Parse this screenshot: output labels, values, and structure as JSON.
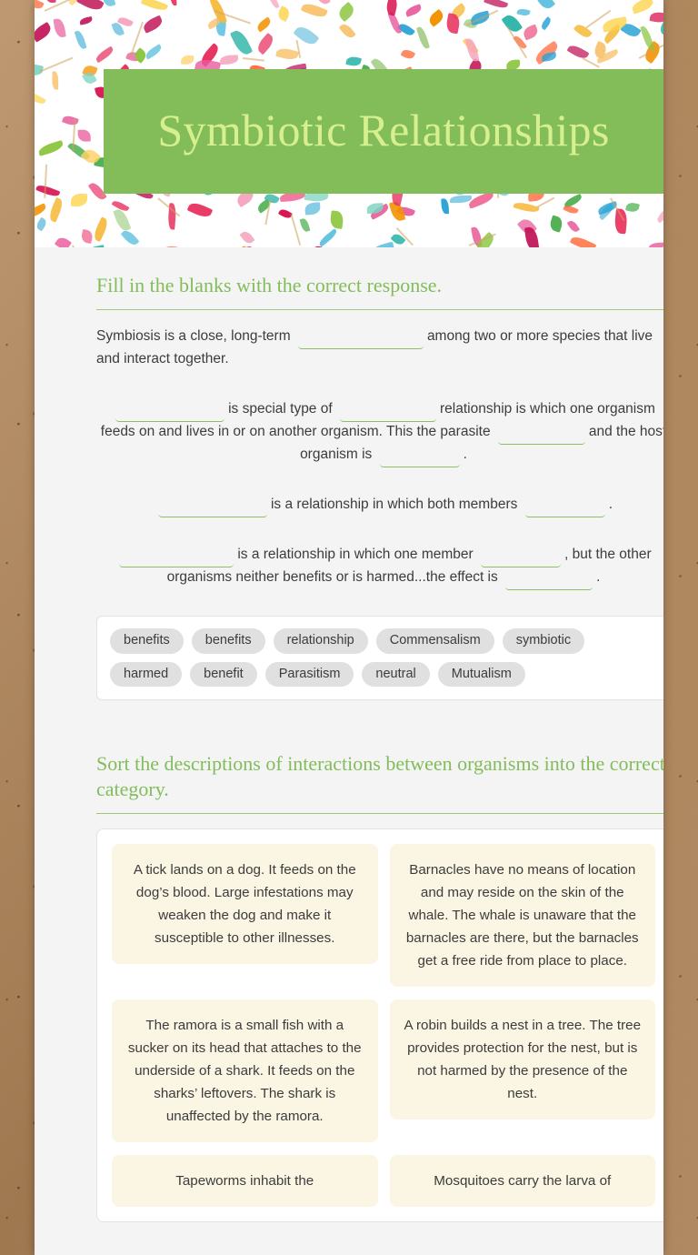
{
  "worksheet": {
    "title": "Symbiotic Relationships",
    "banner_color": "#82bd5a",
    "title_color": "#d7ef8e"
  },
  "section1": {
    "heading": "Fill in the blanks with the correct response.",
    "paragraphs": [
      {
        "id": "p1",
        "segments": [
          {
            "type": "text",
            "value": "Symbiosis is a close, long-term"
          },
          {
            "type": "blank",
            "size": "w1"
          },
          {
            "type": "text",
            "value": "among two or more species that live and interact together."
          }
        ]
      },
      {
        "id": "p2",
        "segments": [
          {
            "type": "blank",
            "size": "w2"
          },
          {
            "type": "text",
            "value": "is special type of"
          },
          {
            "type": "blank",
            "size": "w3"
          },
          {
            "type": "text",
            "value": "relationship is which one organism feeds on and lives in or on another organism. This the parasite"
          },
          {
            "type": "blank",
            "size": "w4"
          },
          {
            "type": "text",
            "value": "and the host organism is"
          },
          {
            "type": "blank",
            "size": "w5"
          },
          {
            "type": "text",
            "value": "."
          }
        ]
      },
      {
        "id": "p3",
        "segments": [
          {
            "type": "blank",
            "size": "w2"
          },
          {
            "type": "text",
            "value": "is a relationship in which both members"
          },
          {
            "type": "blank",
            "size": "w5"
          },
          {
            "type": "text",
            "value": "."
          }
        ]
      },
      {
        "id": "p4",
        "segments": [
          {
            "type": "blank",
            "size": "w6"
          },
          {
            "type": "text",
            "value": "is a relationship in which one member"
          },
          {
            "type": "blank",
            "size": "w5"
          },
          {
            "type": "text",
            "value": ", but the other organisms neither benefits or is harmed...the effect is"
          },
          {
            "type": "blank",
            "size": "w4"
          },
          {
            "type": "text",
            "value": "."
          }
        ]
      }
    ],
    "word_bank": [
      "benefits",
      "benefits",
      "relationship",
      "Commensalism",
      "symbiotic",
      "harmed",
      "benefit",
      "Parasitism",
      "neutral",
      "Mutualism"
    ]
  },
  "section2": {
    "heading": "Sort the descriptions of interactions between organisms into the correct category.",
    "cards": [
      "A tick lands on a dog. It feeds on the dog’s blood. Large infestations may weaken the dog and make it susceptible to other illnesses.",
      "Barnacles have no means of location and may reside on the skin of the whale.  The whale is unaware that the barnacles are there, but the barnacles get a free ride from place to place.",
      "The ramora is a small fish with a sucker on its head that attaches to the underside of a shark. It feeds on the sharks’ leftovers. The shark is unaffected by the ramora.",
      "A robin builds a nest in a tree. The tree provides protection for the nest, but is not harmed by the presence of the nest.",
      "Tapeworms inhabit the",
      "Mosquitoes carry the larva of"
    ]
  }
}
